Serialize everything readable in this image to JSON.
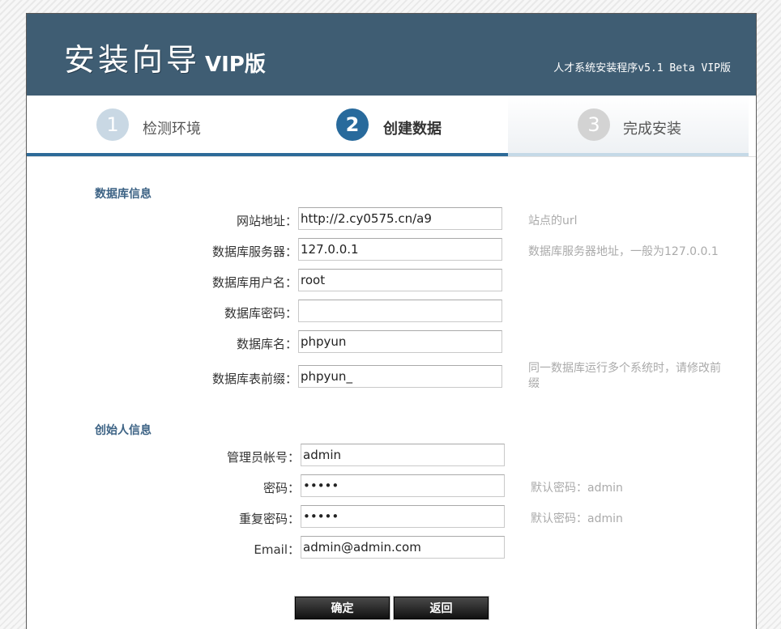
{
  "header": {
    "logo_text": "安装向导",
    "logo_vip": "VIP版",
    "subtitle": "人才系统安装程序v5.1 Beta VIP版"
  },
  "steps": [
    {
      "number": "1",
      "label": "检测环境",
      "state": "done"
    },
    {
      "number": "2",
      "label": "创建数据",
      "state": "active"
    },
    {
      "number": "3",
      "label": "完成安装",
      "state": "pending"
    }
  ],
  "db_section": {
    "title": "数据库信息",
    "fields": {
      "site_url": {
        "label": "网站地址：",
        "value": "http://2.cy0575.cn/a9",
        "hint": "站点的url"
      },
      "db_host": {
        "label": "数据库服务器：",
        "value": "127.0.0.1",
        "hint": "数据库服务器地址，一般为127.0.0.1"
      },
      "db_user": {
        "label": "数据库用户名：",
        "value": "root"
      },
      "db_pass": {
        "label": "数据库密码：",
        "value": ""
      },
      "db_name": {
        "label": "数据库名：",
        "value": "phpyun"
      },
      "db_prefix": {
        "label": "数据库表前缀：",
        "value": "phpyun_",
        "hint": "同一数据库运行多个系统时，请修改前缀"
      }
    }
  },
  "admin_section": {
    "title": "创始人信息",
    "fields": {
      "admin_user": {
        "label": "管理员帐号：",
        "value": "admin"
      },
      "admin_pass": {
        "label": "密码：",
        "value": "admin",
        "hint": "默认密码：admin"
      },
      "admin_pass2": {
        "label": "重复密码：",
        "value": "admin",
        "hint": "默认密码：admin"
      },
      "admin_email": {
        "label": "Email：",
        "value": "admin@admin.com"
      }
    }
  },
  "buttons": {
    "confirm": "确定",
    "back": "返回"
  },
  "colors": {
    "header_bg": "#3f5d73",
    "accent": "#286a9c",
    "section_title": "#3d6385",
    "hint": "#aaaaaa"
  }
}
